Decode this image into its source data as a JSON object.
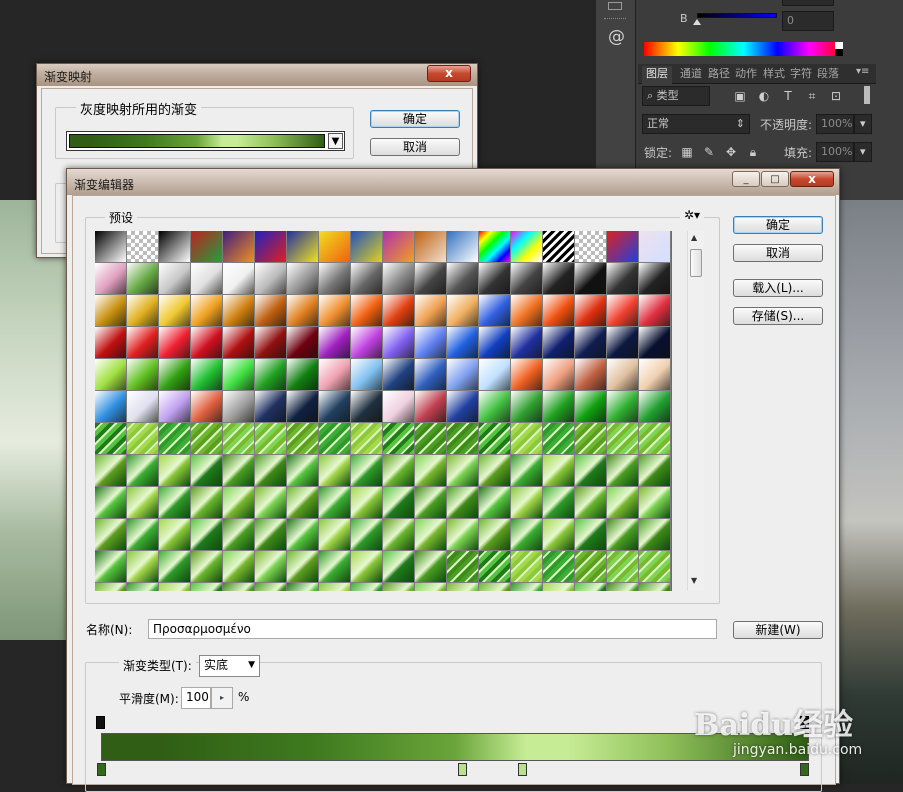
{
  "ps_panel": {
    "b_label": "B",
    "b_value": "0",
    "tabs": [
      "图层",
      "通道",
      "路径",
      "动作",
      "样式",
      "字符",
      "段落"
    ],
    "kind_filter": "类型",
    "blend_mode": "正常",
    "opacity_label": "不透明度:",
    "opacity_value": "100%",
    "lock_label": "锁定:",
    "fill_label": "填充:",
    "fill_value": "100%"
  },
  "gradient_map_dialog": {
    "title": "渐变映射",
    "group_label": "灰度映射所用的渐变",
    "ok_label": "确定",
    "cancel_label": "取消",
    "close_label": "x"
  },
  "gradient_editor": {
    "title": "渐变编辑器",
    "presets_label": "预设",
    "ok_label": "确定",
    "cancel_label": "取消",
    "load_label": "载入(L)...",
    "save_label": "存储(S)...",
    "name_label": "名称(N):",
    "name_value": "Προσαρμοσμένο",
    "new_label": "新建(W)",
    "gradient_type_label": "渐变类型(T):",
    "gradient_type_value": "实底",
    "smoothness_label": "平滑度(M):",
    "smoothness_value": "100",
    "smoothness_unit": "%",
    "min_label": "_",
    "max_label": "□",
    "close_label": "x"
  },
  "colors": {
    "gradient_dark": "#2f5e14",
    "gradient_mid": "#6aa53a",
    "gradient_light": "#c6ec95",
    "stop_dark": "#336a1a",
    "stop_light": "#b6e28a"
  },
  "watermark": {
    "brand": "Baidu经验",
    "url": "jingyan.baidu.com"
  }
}
